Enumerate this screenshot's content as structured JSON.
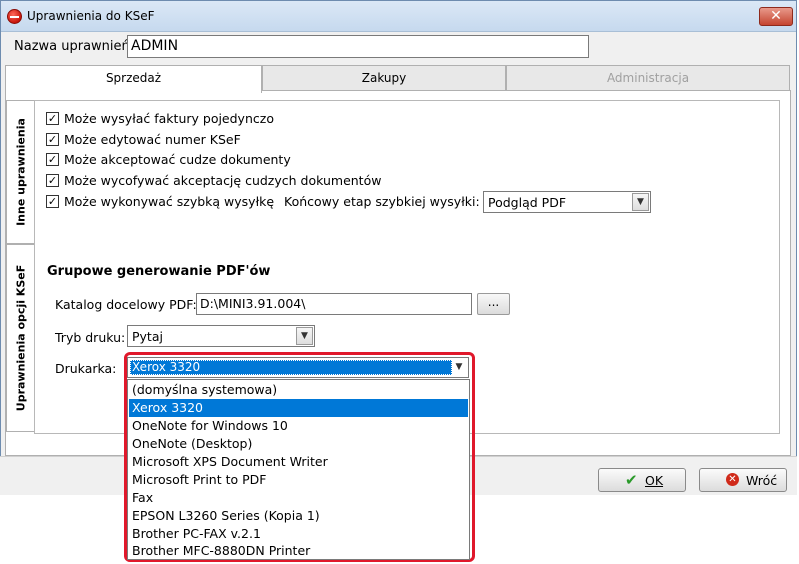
{
  "window": {
    "title": "Uprawnienia do KSeF",
    "close_symbol": "✕"
  },
  "name_field": {
    "label": "Nazwa  uprawnień",
    "value": "ADMIN"
  },
  "top_tabs": [
    {
      "label": "Sprzedaż",
      "state": "active"
    },
    {
      "label": "Zakupy",
      "state": "normal"
    },
    {
      "label": "Administracja",
      "state": "disabled"
    }
  ],
  "side_tabs": [
    {
      "label": "Inne uprawnienia"
    },
    {
      "label": "Uprawnienia opcji KSeF"
    }
  ],
  "checkboxes": [
    {
      "label": "Może wysyłać faktury pojedynczo",
      "checked": true
    },
    {
      "label": "Może edytować numer KSeF",
      "checked": true
    },
    {
      "label": "Może akceptować cudze dokumenty",
      "checked": true
    },
    {
      "label": "Może wycofywać akceptację cudzych dokumentów",
      "checked": true
    },
    {
      "label": "Może wykonywać szybką wysyłkę",
      "checked": true
    }
  ],
  "fast_send": {
    "label": "Końcowy etap szybkiej wysyłki:",
    "value": "Podgląd PDF"
  },
  "pdf_section": {
    "title": "Grupowe generowanie PDF'ów",
    "folder_label": "Katalog docelowy PDF:",
    "folder_value": "D:\\MINI3.91.004\\",
    "browse_label": "...",
    "print_mode_label": "Tryb druku:",
    "print_mode_value": "Pytaj",
    "printer_label": "Drukarka:",
    "printer_value": "Xerox 3320",
    "printer_options": [
      "(domyślna systemowa)",
      "Xerox 3320",
      "OneNote for Windows 10",
      "OneNote (Desktop)",
      "Microsoft XPS Document Writer",
      "Microsoft Print to PDF",
      "Fax",
      "EPSON L3260 Series (Kopia 1)",
      "Brother PC-FAX v.2.1",
      "Brother MFC-8880DN Printer"
    ],
    "selected_index": 1
  },
  "buttons": {
    "ok": "OK",
    "cancel": "Wróć"
  },
  "colors": {
    "highlight": "#0078d7",
    "dropdown_frame": "#e0182b"
  }
}
